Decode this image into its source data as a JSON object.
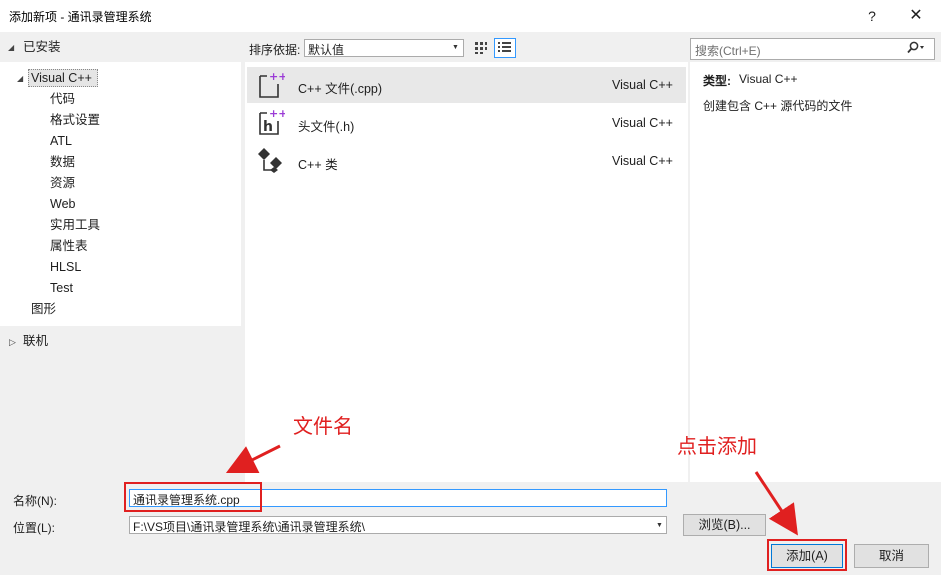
{
  "window": {
    "title": "添加新项 - 通讯录管理系统",
    "help_glyph": "?",
    "close_glyph": "✕"
  },
  "tree": {
    "installed": "已安装",
    "visual_cpp": "Visual C++",
    "children": [
      "代码",
      "格式设置",
      "ATL",
      "数据",
      "资源",
      "Web",
      "实用工具",
      "属性表",
      "HLSL",
      "Test"
    ],
    "graphics": "图形",
    "online": "联机"
  },
  "toolbar": {
    "sort_label": "排序依据:",
    "sort_value": "默认值",
    "search_placeholder": "搜索(Ctrl+E)"
  },
  "templates": [
    {
      "name": "C++ 文件(.cpp)",
      "category": "Visual C++",
      "icon": "cpp-file-icon",
      "selected": true
    },
    {
      "name": "头文件(.h)",
      "category": "Visual C++",
      "icon": "header-file-icon",
      "selected": false
    },
    {
      "name": "C++ 类",
      "category": "Visual C++",
      "icon": "cpp-class-icon",
      "selected": false
    }
  ],
  "info": {
    "type_label": "类型:",
    "type_value": "Visual C++",
    "description": "创建包含 C++ 源代码的文件"
  },
  "form": {
    "name_label": "名称(N):",
    "name_value": "通讯录管理系统.cpp",
    "location_label": "位置(L):",
    "location_value": "F:\\VS项目\\通讯录管理系统\\通讯录管理系统\\",
    "browse_label": "浏览(B)...",
    "add_label": "添加(A)",
    "cancel_label": "取消"
  },
  "annotations": {
    "file_name": "文件名",
    "click_add": "点击添加"
  },
  "colors": {
    "annotation": "#e02020",
    "accent": "#3399ff",
    "icon_purple": "#9b3bd6"
  }
}
